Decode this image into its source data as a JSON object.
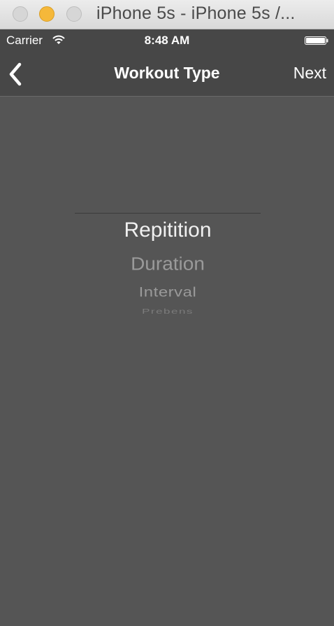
{
  "window": {
    "title": "iPhone 5s - iPhone 5s /..."
  },
  "status_bar": {
    "carrier": "Carrier",
    "time": "8:48 AM"
  },
  "nav_bar": {
    "title": "Workout Type",
    "next_label": "Next",
    "back_icon": "chevron-left-icon"
  },
  "picker": {
    "selected": "Repitition",
    "options": [
      "Repitition",
      "Duration",
      "Interval",
      "Prebens"
    ]
  },
  "colors": {
    "background": "#555555",
    "bars": "#474747",
    "minimize": "#f5b83a"
  }
}
